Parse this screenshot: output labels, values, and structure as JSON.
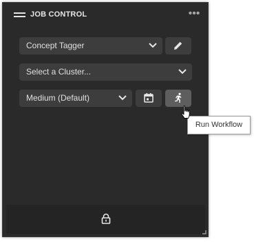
{
  "panel": {
    "title": "JOB CONTROL",
    "menu_icon": "hamburger-menu-icon",
    "more_icon": "more-horizontal-icon",
    "more_glyph": "•••"
  },
  "tagger": {
    "selected": "Concept Tagger",
    "edit_icon": "pencil-icon"
  },
  "cluster": {
    "placeholder": "Select a Cluster..."
  },
  "priority": {
    "selected": "Medium (Default)",
    "schedule_icon": "calendar-icon",
    "run_icon": "running-person-icon"
  },
  "tooltip": {
    "text": "Run Workflow"
  },
  "footer": {
    "lock_icon": "lock-icon"
  },
  "colors": {
    "panel_bg": "#2a2a2a",
    "control_bg": "#3d3d3d",
    "active_button_bg": "#5e5e5e",
    "text": "#e0e0e0"
  }
}
